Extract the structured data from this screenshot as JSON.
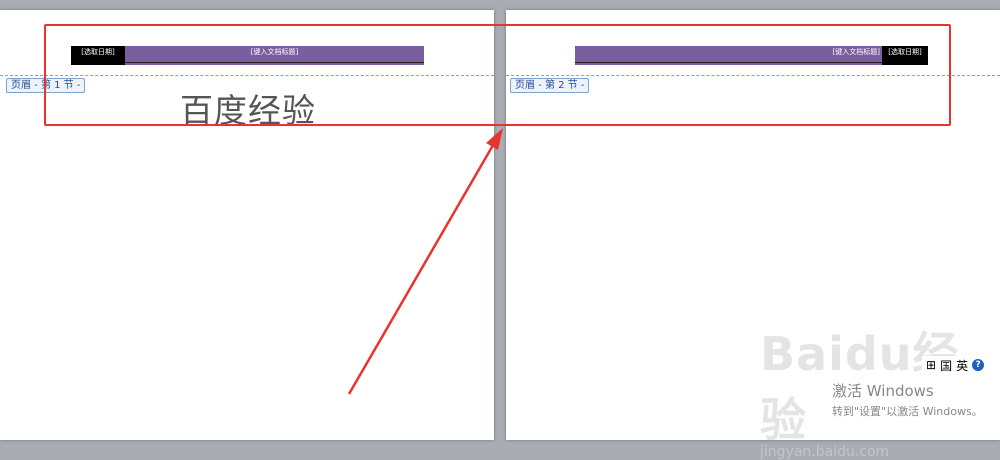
{
  "page1": {
    "date_placeholder": "[选取日期]",
    "title_placeholder": "[键入文档标题]",
    "section_label": "页眉 - 第 1 节 -",
    "body_text": "百度经验"
  },
  "page2": {
    "title_placeholder": "[键入文档标题]",
    "date_placeholder": "[选取日期]",
    "section_label": "页眉 - 第 2 节 -"
  },
  "ime_bar": {
    "icon1": "⊞",
    "icon2": "国",
    "lang": "英",
    "help": "?"
  },
  "watermark": {
    "logo": "Baidu经验",
    "url": "jingyan.baidu.com"
  },
  "activation": {
    "title": "激活 Windows",
    "subtitle": "转到\"设置\"以激活 Windows。"
  },
  "colors": {
    "title_bar": "#7b5ea0",
    "date_bar": "#000000",
    "annotation": "#e8332e"
  }
}
